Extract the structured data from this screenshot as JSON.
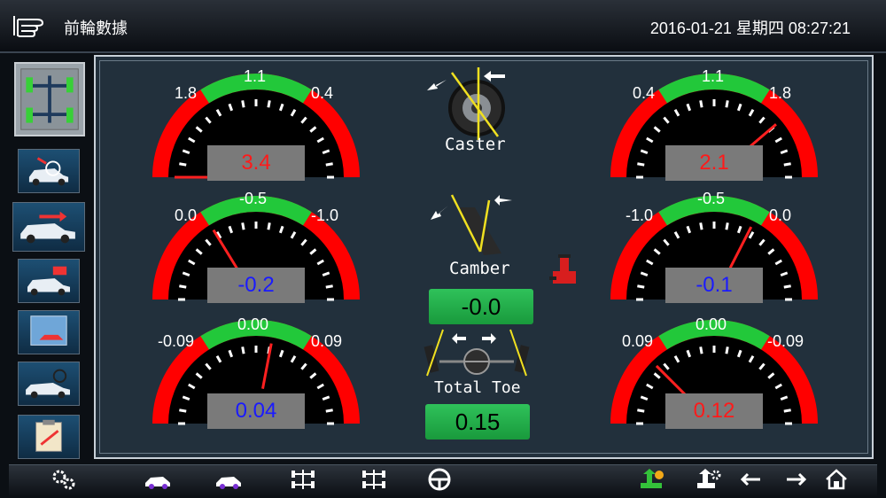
{
  "header": {
    "title": "前輪數據",
    "datetime": "2016-01-21 星期四 08:27:21"
  },
  "colors": {
    "red_value": "#ff1a1a",
    "blue_value": "#1a1aff",
    "gauge_red": "#ff0000",
    "gauge_green": "#22c83a",
    "ok_green": "#22b24a"
  },
  "gauges": {
    "caster_left": {
      "left_label": "1.8",
      "top_label": "1.1",
      "right_label": "0.4",
      "value": "3.4",
      "value_color": "red",
      "needle_level": -1.0
    },
    "caster_right": {
      "left_label": "0.4",
      "top_label": "1.1",
      "right_label": "1.8",
      "value": "2.1",
      "value_color": "red",
      "needle_level": 0.55
    },
    "camber_left": {
      "left_label": "0.0",
      "top_label": "-0.5",
      "right_label": "-1.0",
      "value": "-0.2",
      "value_color": "blue",
      "needle_level": -0.35
    },
    "camber_right": {
      "left_label": "-1.0",
      "top_label": "-0.5",
      "right_label": "0.0",
      "value": "-0.1",
      "value_color": "blue",
      "needle_level": 0.3
    },
    "toe_left": {
      "left_label": "-0.09",
      "top_label": "0.00",
      "right_label": "0.09",
      "value": "0.04",
      "value_color": "blue",
      "needle_level": 0.12
    },
    "toe_right": {
      "left_label": "0.09",
      "top_label": "0.00",
      "right_label": "-0.09",
      "value": "0.12",
      "value_color": "red",
      "needle_level": -0.5
    }
  },
  "center": {
    "caster_label": "Caster",
    "camber_label": "Camber",
    "camber_value": "-0.0",
    "toe_label": "Total Toe",
    "toe_value": "0.15"
  },
  "sidebar": {
    "items": [
      {
        "icon": "front-axle-icon"
      },
      {
        "icon": "car-search-icon"
      },
      {
        "icon": "car-arrow-icon"
      },
      {
        "icon": "car-lift-icon"
      },
      {
        "icon": "car-display-icon"
      },
      {
        "icon": "car-steering-icon"
      },
      {
        "icon": "report-icon"
      }
    ]
  },
  "bottombar": {
    "icons": [
      "settings-icon",
      "car-front-icon",
      "car-rear-icon",
      "axle-front-icon",
      "axle-rear-icon",
      "steering-wheel-icon",
      "lift-up-icon",
      "lift-settings-icon",
      "back-arrow-icon",
      "forward-arrow-icon",
      "home-icon"
    ]
  }
}
